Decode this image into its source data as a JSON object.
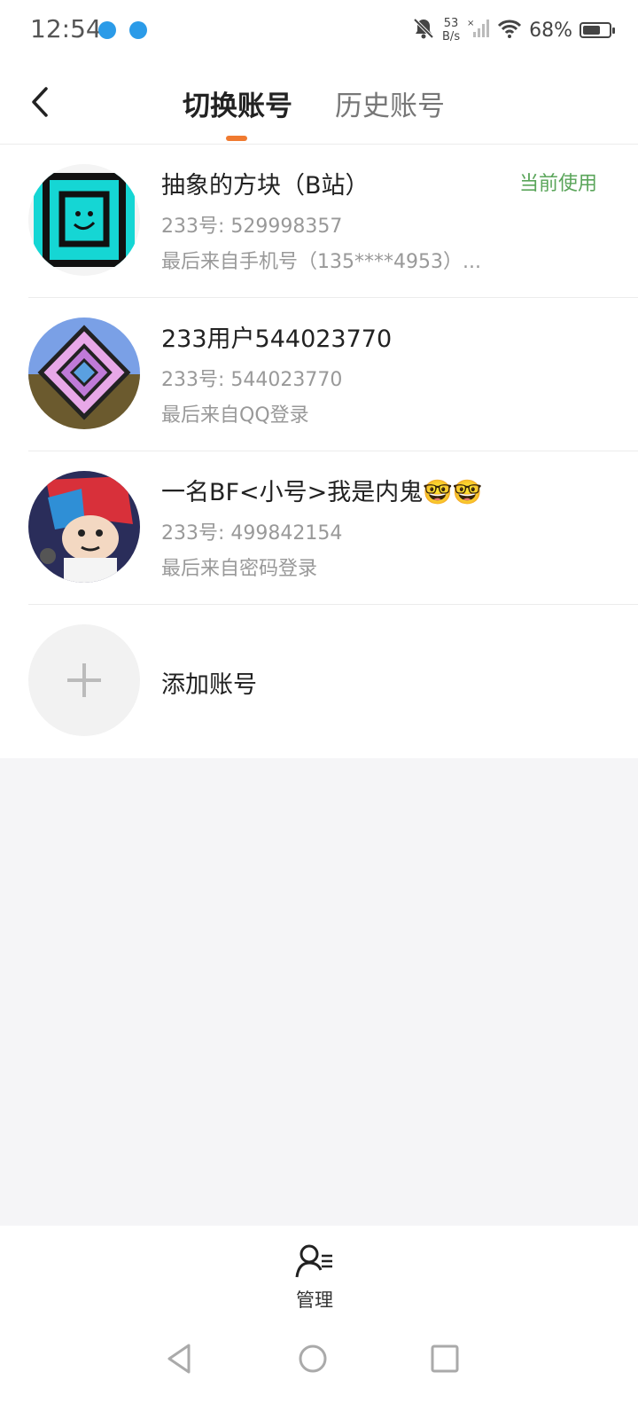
{
  "status_bar": {
    "time": "12:54",
    "net_speed_value": "53",
    "net_speed_unit": "B/s",
    "battery_percent": "68%",
    "battery_level": 0.68,
    "icons": [
      "browser-app-icon",
      "browser-app-icon",
      "bell-off-icon",
      "signal-icon",
      "wifi-icon",
      "battery-icon"
    ]
  },
  "header": {
    "back_icon": "chevron-left-icon",
    "tabs": [
      {
        "label": "切换账号",
        "active": true
      },
      {
        "label": "历史账号",
        "active": false
      }
    ],
    "indicator_color": "#f07a30"
  },
  "accounts": [
    {
      "name": "抽象的方块（B站）",
      "id_text": "233号: 529998357",
      "source": "最后来自手机号（135****4953）...",
      "current_label": "当前使用"
    },
    {
      "name": "233用户544023770",
      "id_text": "233号: 544023770",
      "source": "最后来自QQ登录"
    },
    {
      "name": "一名BF<小号>我是内鬼🤓🤓",
      "id_text": "233号: 499842154",
      "source": "最后来自密码登录"
    }
  ],
  "add_account": {
    "label": "添加账号",
    "icon": "plus-icon"
  },
  "bottom": {
    "manage_label": "管理",
    "manage_icon": "user-list-icon",
    "nav_icons": [
      "back-triangle-icon",
      "home-circle-icon",
      "recents-square-icon"
    ]
  },
  "colors": {
    "accent": "#f07a30",
    "current": "#5aa55a",
    "muted": "#999999"
  }
}
